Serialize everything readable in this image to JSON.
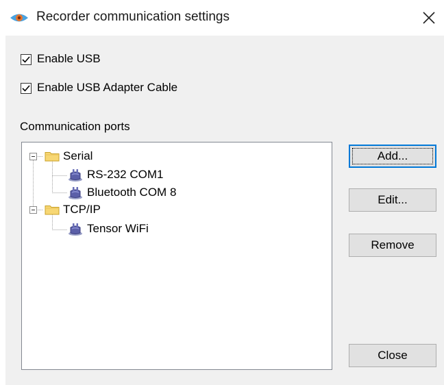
{
  "window": {
    "title": "Recorder communication settings",
    "app_icon": "eye-icon",
    "close_icon": "close-icon"
  },
  "options": {
    "enable_usb": {
      "label": "Enable USB",
      "checked": true
    },
    "enable_usb_adapter": {
      "label": "Enable USB Adapter Cable",
      "checked": true
    }
  },
  "ports": {
    "label": "Communication ports",
    "tree": [
      {
        "label": "Serial",
        "icon": "folder-icon",
        "expanded": true,
        "children": [
          {
            "label": "RS-232 COM1",
            "icon": "port-plug-icon"
          },
          {
            "label": "Bluetooth COM 8",
            "icon": "port-plug-icon"
          }
        ]
      },
      {
        "label": "TCP/IP",
        "icon": "folder-icon",
        "expanded": true,
        "children": [
          {
            "label": "Tensor WiFi",
            "icon": "port-plug-icon"
          }
        ]
      }
    ]
  },
  "buttons": {
    "add": "Add...",
    "edit": "Edit...",
    "remove": "Remove",
    "close": "Close"
  },
  "colors": {
    "accent": "#0078d7",
    "dialog_bg": "#f0f0f0",
    "button_bg": "#e1e1e1",
    "folder": "#f7d774",
    "plug": "#5b5fa8"
  }
}
